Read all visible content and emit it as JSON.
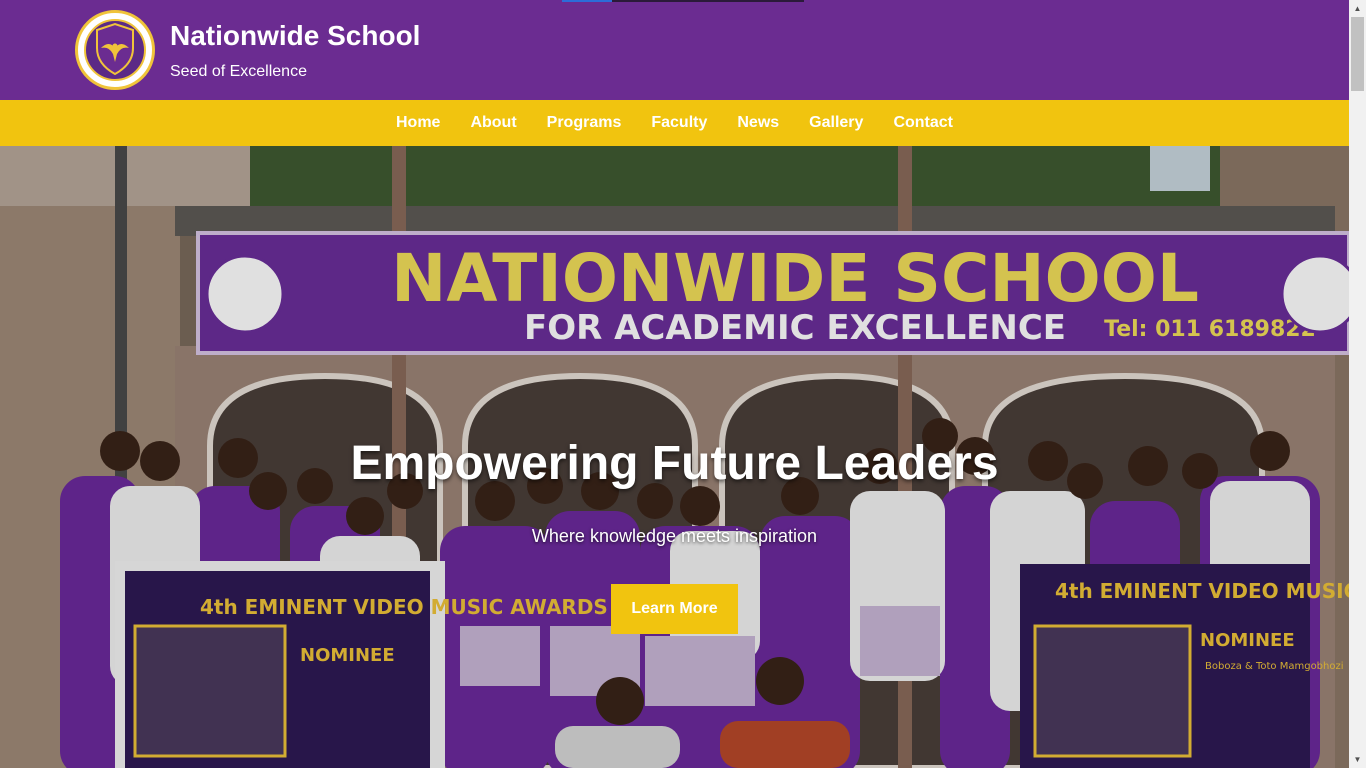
{
  "site": {
    "name": "Nationwide School",
    "tagline": "Seed of Excellence"
  },
  "nav": {
    "items": [
      {
        "label": "Home"
      },
      {
        "label": "About"
      },
      {
        "label": "Programs"
      },
      {
        "label": "Faculty"
      },
      {
        "label": "News"
      },
      {
        "label": "Gallery"
      },
      {
        "label": "Contact"
      }
    ]
  },
  "hero": {
    "title": "Empowering Future Leaders",
    "subtitle": "Where knowledge meets inspiration",
    "button_label": "Learn More",
    "photo": {
      "sign_title": "NATIONWIDE SCHOOL",
      "sign_subtitle": "FOR ACADEMIC EXCELLENCE",
      "sign_phone": "Tel: 011 6189822",
      "banner_left": "4th EMINENT VIDEO MUSIC AWARDS",
      "banner_nominee": "NOMINEE",
      "banner_names": "Boboza & Toto Mamgobhozi"
    }
  },
  "colors": {
    "header_purple": "#6b2c91",
    "nav_yellow": "#f1c40f",
    "text_white": "#ffffff"
  }
}
